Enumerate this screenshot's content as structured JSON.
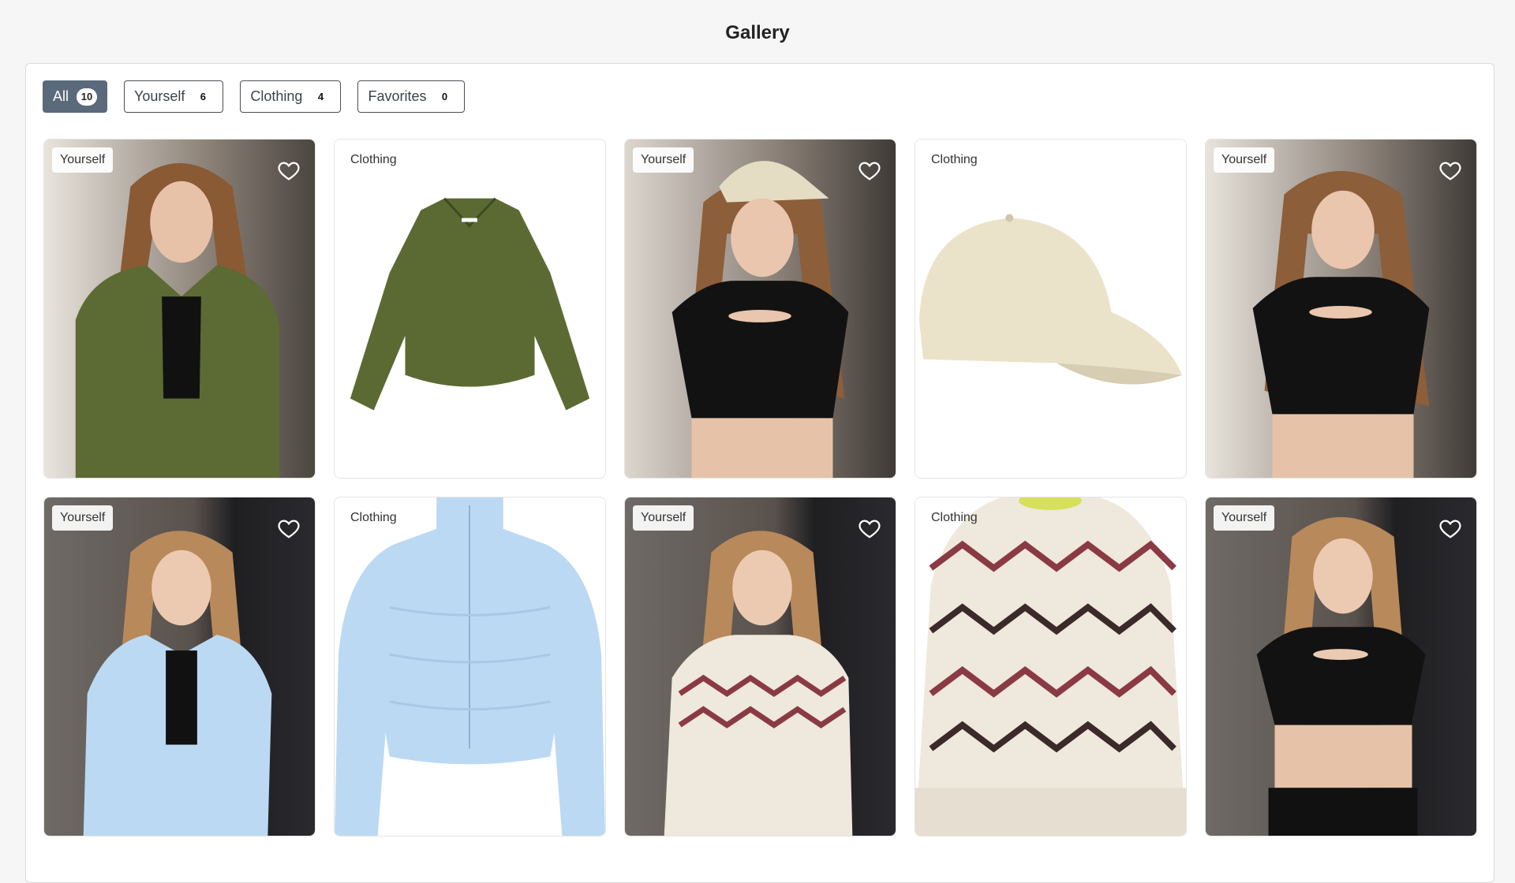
{
  "page": {
    "title": "Gallery"
  },
  "filters": [
    {
      "label": "All",
      "count": "10",
      "active": true
    },
    {
      "label": "Yourself",
      "count": "6"
    },
    {
      "label": "Clothing",
      "count": "4"
    },
    {
      "label": "Favorites",
      "count": "0"
    }
  ],
  "cards": [
    {
      "tag": "Yourself",
      "kind": "photo",
      "subject": "woman in olive suede jacket"
    },
    {
      "tag": "Clothing",
      "kind": "product",
      "subject": "olive suede jacket"
    },
    {
      "tag": "Yourself",
      "kind": "photo",
      "subject": "woman in beige cap and black crop top"
    },
    {
      "tag": "Clothing",
      "kind": "product",
      "subject": "beige baseball cap"
    },
    {
      "tag": "Yourself",
      "kind": "photo",
      "subject": "woman in black crop top"
    },
    {
      "tag": "Yourself",
      "kind": "photo",
      "subject": "woman in light blue puffer jacket"
    },
    {
      "tag": "Clothing",
      "kind": "product",
      "subject": "light blue puffer jacket"
    },
    {
      "tag": "Yourself",
      "kind": "photo",
      "subject": "woman in patterned knit sweater"
    },
    {
      "tag": "Clothing",
      "kind": "product",
      "subject": "cream and burgundy knit sweater"
    },
    {
      "tag": "Yourself",
      "kind": "photo",
      "subject": "woman in black crop top"
    }
  ],
  "icons": {
    "favorite": "heart-outline-icon"
  },
  "colors": {
    "active_filter": "#5a6a7b",
    "olive": "#5b6a32",
    "beige": "#ebe3c9",
    "sky_blue": "#bcd9f3",
    "burgundy": "#8a3a43",
    "cream": "#efe8dc"
  }
}
